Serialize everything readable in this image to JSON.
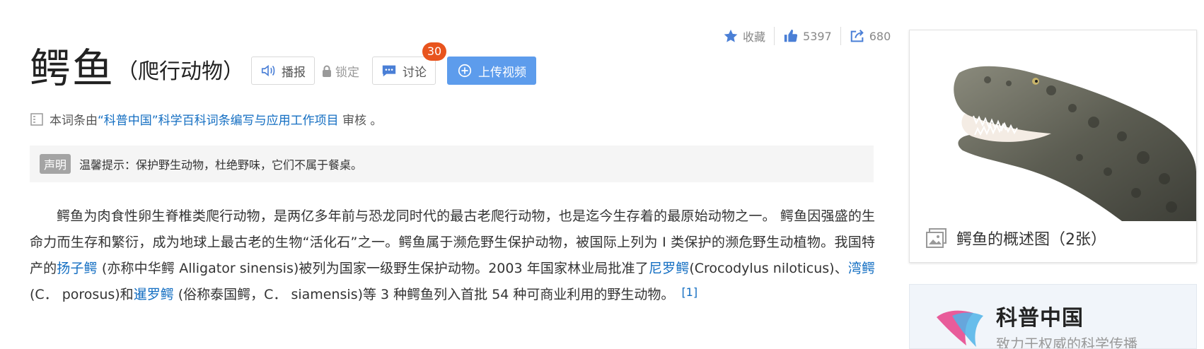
{
  "top_actions": {
    "favorite_label": "收藏",
    "like_count": "5397",
    "share_count": "680"
  },
  "header": {
    "title": "鳄鱼",
    "subtitle": "（爬行动物）",
    "broadcast_label": "播报",
    "lock_label": "锁定",
    "discuss_label": "讨论",
    "discuss_badge": "30",
    "upload_label": "上传视频"
  },
  "review": {
    "prefix": "本词条由",
    "link": "“科普中国”科学百科词条编写与应用工作项目",
    "suffix": " 审核 。"
  },
  "notice": {
    "tag": "声明",
    "text": "温馨提示：保护野生动物，杜绝野味，它们不属于餐桌。"
  },
  "body": {
    "t1": "鳄鱼为肉食性卵生脊椎类爬行动物，是两亿多年前与恐龙同时代的最古老爬行动物，也是迄今生存着的最原始动物之一。 鳄鱼因强盛的生命力而生存和繁衍，成为地球上最古老的生物“活化石”之一。鳄鱼属于濒危野生保护动物，被国际上列为 I 类保护的濒危野生动植物。我国特产的",
    "link1": "扬子鳄",
    "t2": " (亦称中华鳄 Alligator sinensis)被列为国家一级野生保护动物。2003 年国家林业局批准了",
    "link2": "尼罗鳄",
    "t3": "(Crocodylus niloticus)、",
    "link3": "湾鳄",
    "t4": " (C． porosus)和",
    "link4": "暹罗鳄",
    "t5": " (俗称泰国鳄，C． siamensis)等 3 种鳄鱼列入首批 54 种可商业利用的野生动物。",
    "ref": "[1]"
  },
  "sidebar": {
    "image_caption": "鳄鱼的概述图（2张）",
    "brand_name": "科普中国",
    "brand_slogan": "致力于权威的科学传播"
  }
}
